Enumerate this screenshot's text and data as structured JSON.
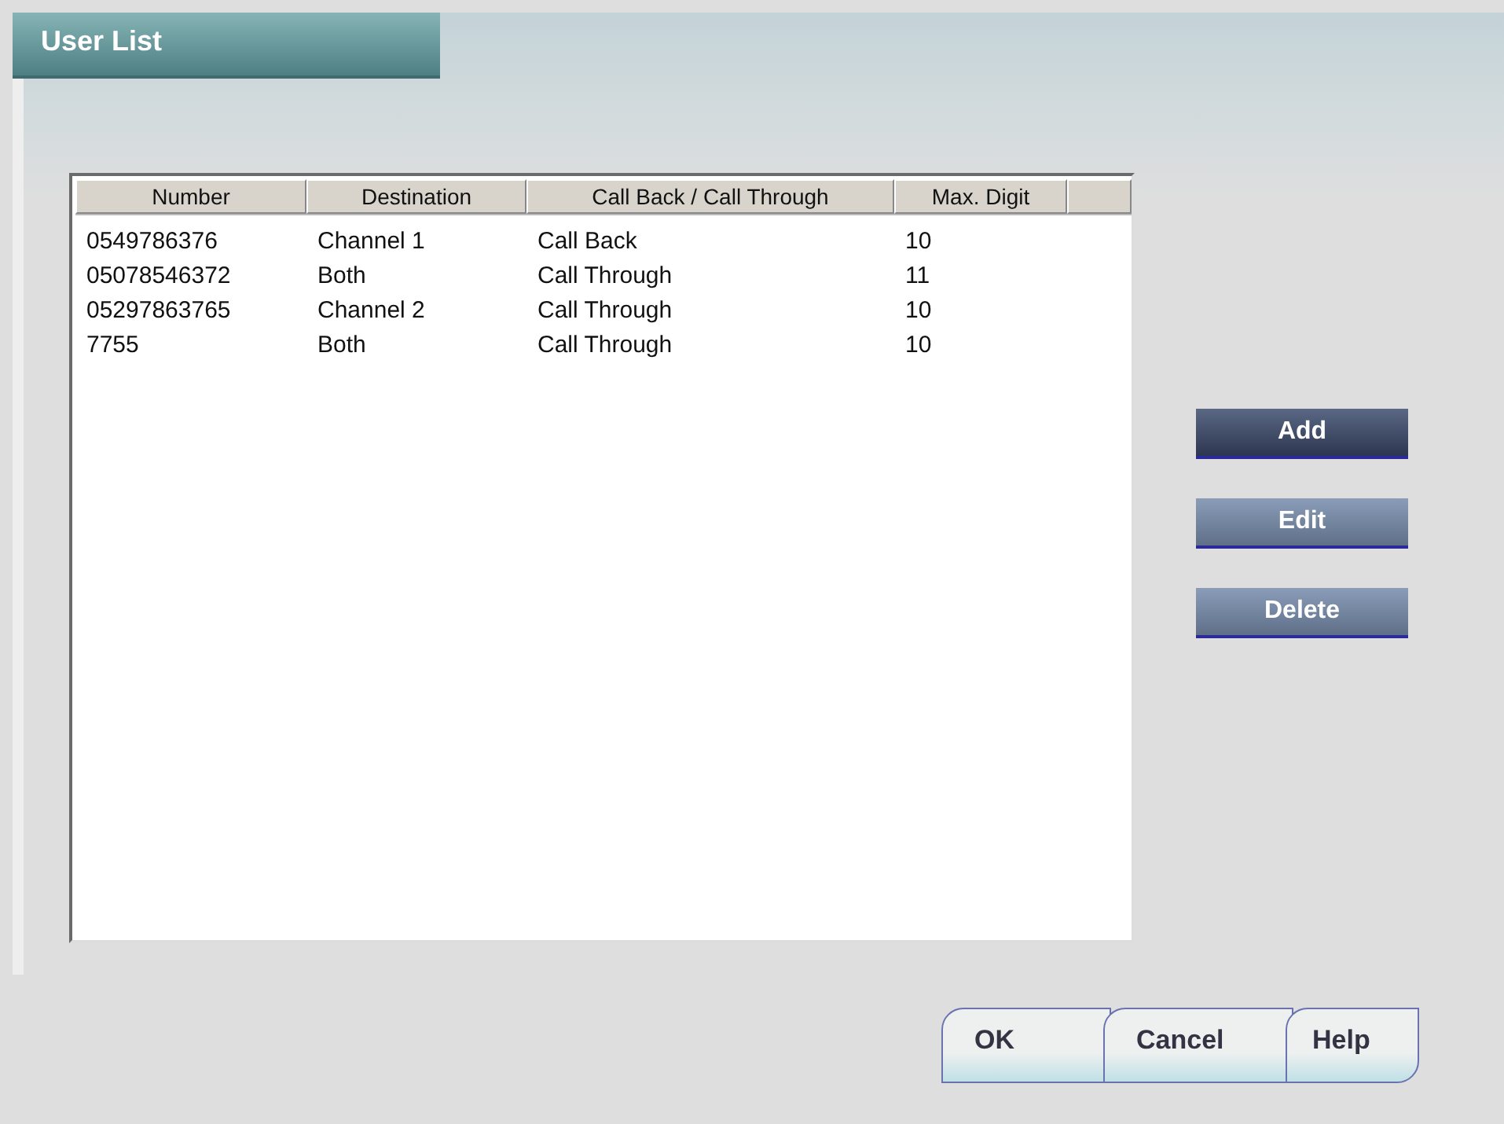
{
  "window": {
    "title": "User List"
  },
  "table": {
    "columns": [
      "Number",
      "Destination",
      "Call Back / Call Through",
      "Max. Digit"
    ],
    "rows": [
      [
        "0549786376",
        "Channel 1",
        "Call Back",
        "10"
      ],
      [
        "05078546372",
        "Both",
        "Call Through",
        "11"
      ],
      [
        "05297863765",
        "Channel 2",
        "Call Through",
        "10"
      ],
      [
        "7755",
        "Both",
        "Call Through",
        "10"
      ]
    ]
  },
  "side_buttons": [
    {
      "label": "Add",
      "focused": true
    },
    {
      "label": "Edit",
      "focused": false
    },
    {
      "label": "Delete",
      "focused": false
    }
  ],
  "dialog_buttons": [
    "OK",
    "Cancel",
    "Help"
  ]
}
